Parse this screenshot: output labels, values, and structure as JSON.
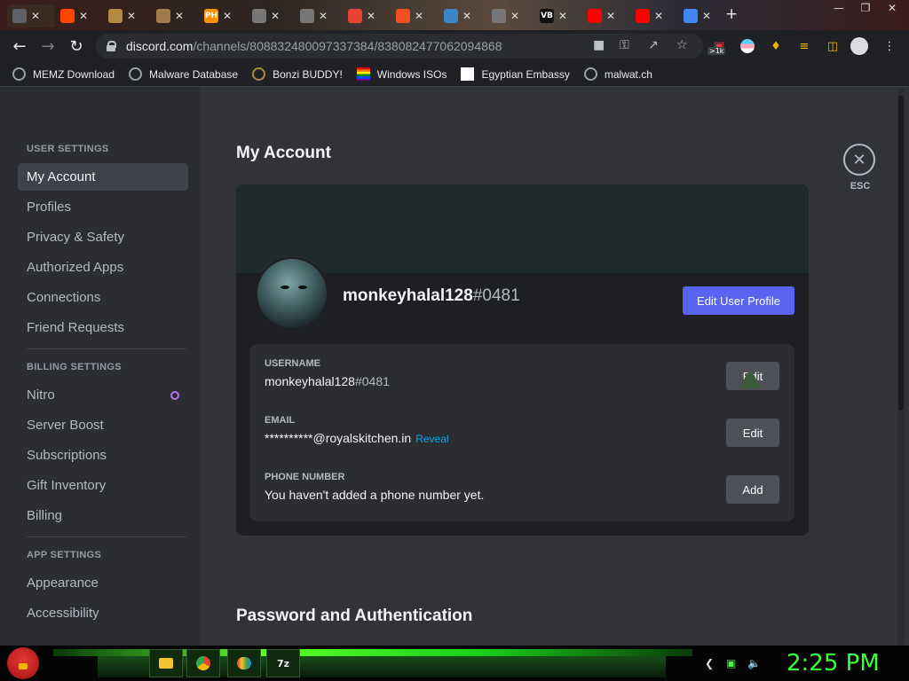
{
  "browser": {
    "tabs": [
      {
        "icon": "speaker-icon",
        "color": "#5f6368"
      },
      {
        "icon": "reddit-icon",
        "color": "#ff4500"
      },
      {
        "icon": "circle-icon",
        "color": "#b08a3e"
      },
      {
        "icon": "circle-icon",
        "color": "#a07a4a"
      },
      {
        "icon": "ph-icon",
        "color": "#ff9000",
        "text": "PH"
      },
      {
        "icon": "page-icon",
        "color": "#777777"
      },
      {
        "icon": "page-icon",
        "color": "#777777"
      },
      {
        "icon": "google-icon",
        "color": "#ea4335"
      },
      {
        "icon": "microsoft-icon",
        "color": "#f25022"
      },
      {
        "icon": "page-icon",
        "color": "#3a86c8"
      },
      {
        "icon": "page-icon",
        "color": "#777777"
      },
      {
        "icon": "vb-icon",
        "color": "#111111",
        "text": "VB"
      },
      {
        "icon": "youtube-icon",
        "color": "#ff0000"
      },
      {
        "icon": "youtube-icon",
        "color": "#ff0000"
      },
      {
        "icon": "chrome-icon",
        "color": "#4285f4"
      }
    ],
    "url_host": "discord.com",
    "url_path": "/channels/808832480097337384/838082477062094868",
    "extension_badge": ">1k",
    "bookmarks": [
      {
        "label": "MEMZ Download",
        "icon": "globe-icon",
        "color": "#9aa0a6"
      },
      {
        "label": "Malware Database",
        "icon": "globe-icon",
        "color": "#9aa0a6"
      },
      {
        "label": "Bonzi BUDDY!",
        "icon": "bonzi-icon",
        "color": "#a58b3a"
      },
      {
        "label": "Windows ISOs",
        "icon": "rainbow-flag-icon",
        "color": "#e91e63"
      },
      {
        "label": "Egyptian Embassy",
        "icon": "wix-icon",
        "color": "#ffffff"
      },
      {
        "label": "malwat.ch",
        "icon": "globe-icon",
        "color": "#9aa0a6"
      }
    ]
  },
  "sidebar": {
    "sections": [
      {
        "heading": "USER SETTINGS",
        "items": [
          "My Account",
          "Profiles",
          "Privacy & Safety",
          "Authorized Apps",
          "Connections",
          "Friend Requests"
        ]
      },
      {
        "heading": "BILLING SETTINGS",
        "items": [
          "Nitro",
          "Server Boost",
          "Subscriptions",
          "Gift Inventory",
          "Billing"
        ]
      },
      {
        "heading": "APP SETTINGS",
        "items": [
          "Appearance",
          "Accessibility"
        ]
      }
    ],
    "selected": "My Account"
  },
  "account": {
    "page_title": "My Account",
    "username": "monkeyhalal128",
    "discriminator": "#0481",
    "edit_profile_label": "Edit User Profile",
    "fields": {
      "username_label": "USERNAME",
      "username_value": "monkeyhalal128",
      "username_disc": "#0481",
      "username_btn": "Edit",
      "email_label": "EMAIL",
      "email_value": "**********@royalskitchen.in",
      "email_reveal": "Reveal",
      "email_btn": "Edit",
      "phone_label": "PHONE NUMBER",
      "phone_value": "You haven't added a phone number yet.",
      "phone_btn": "Add"
    },
    "password_section_title": "Password and Authentication",
    "close_label": "ESC",
    "accent_color": "#5865f2"
  },
  "taskbar": {
    "apps": [
      "file-explorer-icon",
      "chrome-icon",
      "paint-icon",
      "7zip-icon"
    ],
    "app_7z_text": "7z",
    "clock": "2:25 PM"
  }
}
